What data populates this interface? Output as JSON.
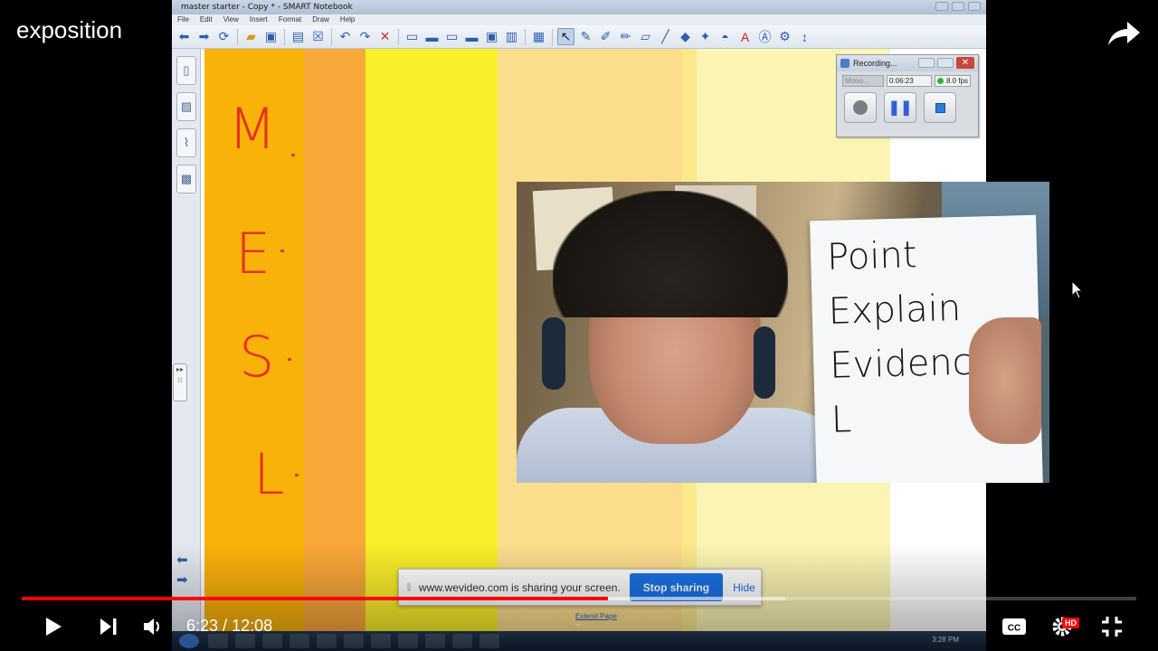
{
  "player": {
    "title": "exposition",
    "time": {
      "current": "6:23",
      "separator": " / ",
      "duration": "12:08"
    },
    "progress_fraction": 0.526,
    "buffered_fraction": 0.685,
    "accent_color": "#ff0000",
    "controls": {
      "play_icon": "play-icon",
      "next_icon": "next-icon",
      "volume_icon": "volume-icon",
      "captions_icon": "captions-icon",
      "settings_icon": "settings-icon",
      "hd_badge": "HD",
      "fullscreen_icon": "exit-fullscreen-icon",
      "share_icon": "share-icon"
    }
  },
  "smart_window": {
    "title": "master starter - Copy * - SMART Notebook",
    "menu": [
      "File",
      "Edit",
      "View",
      "Insert",
      "Format",
      "Draw",
      "Help"
    ],
    "canvas_letters": [
      "M",
      "E",
      "S",
      "L"
    ],
    "stripe_colors": [
      "#f9b20a",
      "#f9a83a",
      "#fbee2a",
      "#fcdd8c",
      "#fbe98a",
      "#fbf4b3",
      "#ffffff"
    ]
  },
  "recorder": {
    "title": "Recording...",
    "mode": "Mono...",
    "elapsed": "0:06:23",
    "fps": "8.0 fps"
  },
  "webcam": {
    "paper_words": [
      "Point",
      "Explain",
      "Evidence",
      "L"
    ]
  },
  "screen_share": {
    "message": "www.wevideo.com is sharing your screen.",
    "stop_label": "Stop sharing",
    "hide_label": "Hide",
    "extend_label": "Extend Page"
  },
  "taskbar": {
    "clock": "3:28 PM"
  }
}
